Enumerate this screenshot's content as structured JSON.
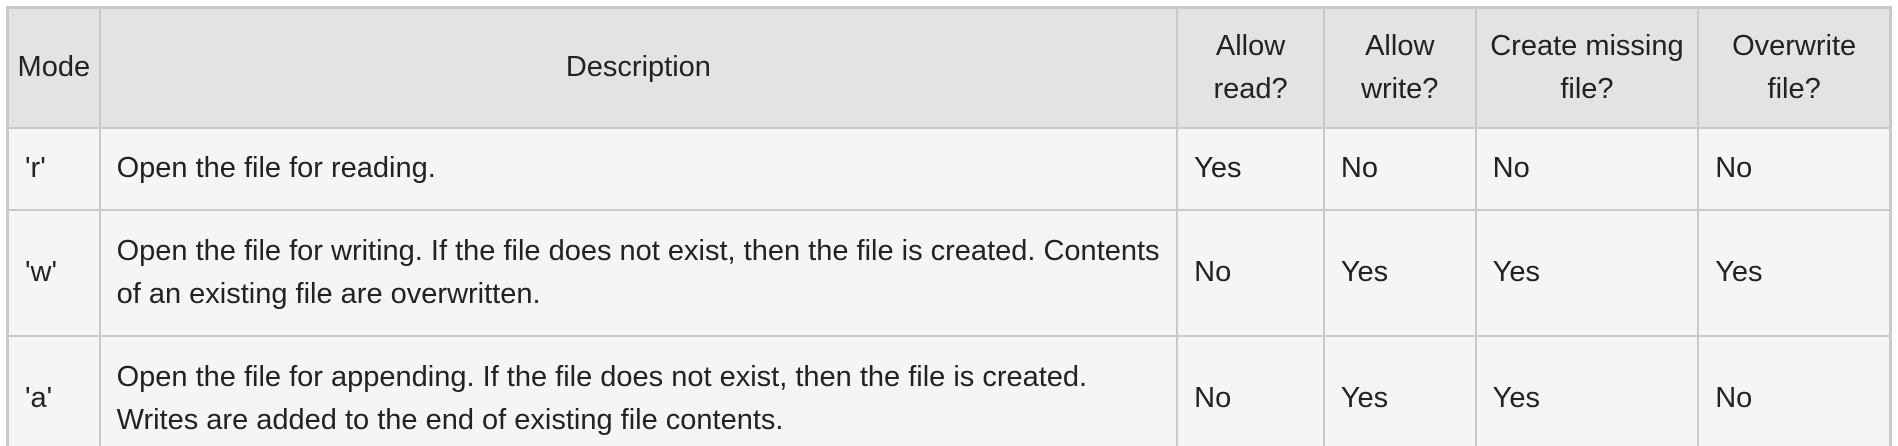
{
  "table": {
    "headers": {
      "mode": "Mode",
      "description": "Description",
      "allow_read": "Allow read?",
      "allow_write": "Allow write?",
      "create_missing": "Create missing file?",
      "overwrite": "Overwrite file?"
    },
    "rows": [
      {
        "mode": "'r'",
        "description": "Open the file for reading.",
        "allow_read": "Yes",
        "allow_write": "No",
        "create_missing": "No",
        "overwrite": "No"
      },
      {
        "mode": "'w'",
        "description": "Open the file for writing. If the file does not exist, then the file is created. Contents of an existing file are overwritten.",
        "allow_read": "No",
        "allow_write": "Yes",
        "create_missing": "Yes",
        "overwrite": "Yes"
      },
      {
        "mode": "'a'",
        "description": "Open the file for appending. If the file does not exist, then the file is created. Writes are added to the end of existing file contents.",
        "allow_read": "No",
        "allow_write": "Yes",
        "create_missing": "Yes",
        "overwrite": "No"
      }
    ]
  }
}
